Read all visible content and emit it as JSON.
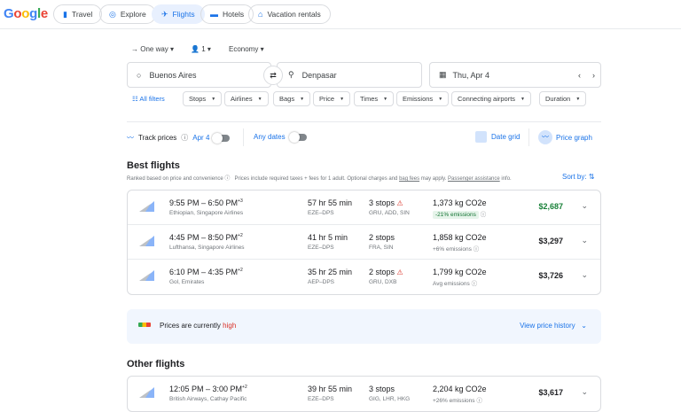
{
  "nav": {
    "logo": "Google",
    "tabs": [
      {
        "label": "Travel",
        "icon": "luggage-icon"
      },
      {
        "label": "Explore",
        "icon": "explore-icon"
      },
      {
        "label": "Flights",
        "icon": "plane-icon",
        "active": true
      },
      {
        "label": "Hotels",
        "icon": "bed-icon"
      },
      {
        "label": "Vacation rentals",
        "icon": "house-icon"
      }
    ]
  },
  "search": {
    "trip_type": "One way",
    "passengers": "1",
    "cabin": "Economy",
    "origin": "Buenos Aires",
    "destination": "Denpasar",
    "date": "Thu, Apr 4"
  },
  "filters": {
    "all": "All filters",
    "chips": [
      "Stops",
      "Airlines",
      "Bags",
      "Price",
      "Times",
      "Emissions",
      "Connecting airports",
      "Duration"
    ]
  },
  "track": {
    "label": "Track prices",
    "date": "Apr 4",
    "any_dates": "Any dates",
    "date_grid": "Date grid",
    "price_graph": "Price graph"
  },
  "best": {
    "title": "Best flights",
    "ranked": "Ranked based on price and convenience",
    "note_pre": "Prices include required taxes + fees for 1 adult. Optional charges and ",
    "bag_fees": "bag fees",
    "note_mid": " may apply. ",
    "passenger": "Passenger assistance",
    "note_post": " info.",
    "sort": "Sort by:"
  },
  "flights": [
    {
      "times": "9:55 PM – 6:50 PM",
      "plus": "+3",
      "airlines": "Ethiopian, Singapore Airlines",
      "duration": "57 hr 55 min",
      "route": "EZE–DPS",
      "stops": "3 stops",
      "warn": true,
      "via": "GRU, ADD, SIN",
      "co2": "1,373 kg CO2e",
      "emissions": "-21% emissions",
      "good": true,
      "price": "$2,687"
    },
    {
      "times": "4:45 PM – 8:50 PM",
      "plus": "+2",
      "airlines": "Lufthansa, Singapore Airlines",
      "duration": "41 hr 5 min",
      "route": "EZE–DPS",
      "stops": "2 stops",
      "warn": false,
      "via": "FRA, SIN",
      "co2": "1,858 kg CO2e",
      "emissions": "+6% emissions",
      "good": false,
      "price": "$3,297"
    },
    {
      "times": "6:10 PM – 4:35 PM",
      "plus": "+2",
      "airlines": "Gol, Emirates",
      "duration": "35 hr 25 min",
      "route": "AEP–DPS",
      "stops": "2 stops",
      "warn": true,
      "via": "GRU, DXB",
      "co2": "1,799 kg CO2e",
      "emissions": "Avg emissions",
      "good": false,
      "price": "$3,726"
    }
  ],
  "insight": {
    "pre": "Prices are currently ",
    "level": "high",
    "link": "View price history"
  },
  "other": {
    "title": "Other flights",
    "flights": [
      {
        "times": "12:05 PM – 3:00 PM",
        "plus": "+2",
        "airlines": "British Airways, Cathay Pacific",
        "duration": "39 hr 55 min",
        "route": "EZE–DPS",
        "stops": "3 stops",
        "via": "GIG, LHR, HKG",
        "co2": "2,204 kg CO2e",
        "emissions": "+26% emissions",
        "price": "$3,617"
      }
    ]
  },
  "colors": {
    "accent": "#1a73e8",
    "good_price": "#188038",
    "warn": "#d93025"
  }
}
